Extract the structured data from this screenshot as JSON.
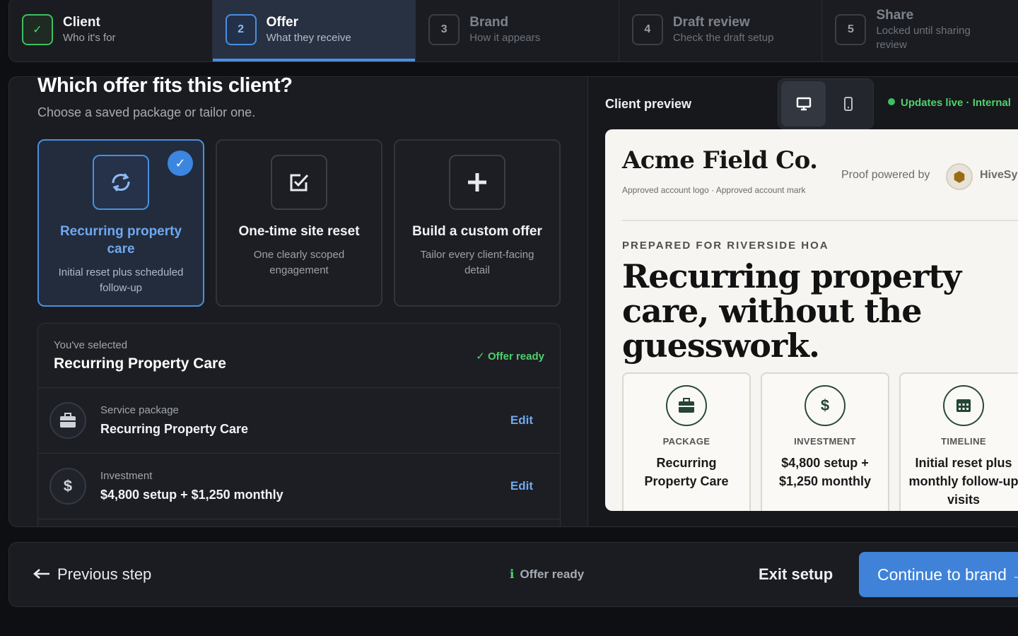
{
  "stepper": {
    "steps": [
      {
        "num": "✓",
        "title": "Client",
        "sub": "Who it's for"
      },
      {
        "num": "2",
        "title": "Offer",
        "sub": "What they receive"
      },
      {
        "num": "3",
        "title": "Brand",
        "sub": "How it appears"
      },
      {
        "num": "4",
        "title": "Draft review",
        "sub": "Check the draft setup"
      },
      {
        "num": "5",
        "title": "Share",
        "sub": "Locked until sharing review"
      }
    ]
  },
  "offer": {
    "title": "Which offer fits this client?",
    "subtitle": "Choose a saved package or tailor one.",
    "cards": [
      {
        "title": "Recurring property care",
        "desc": "Initial reset plus scheduled follow-up",
        "icon": "recurring-icon"
      },
      {
        "title": "One-time site reset",
        "desc": "One clearly scoped engagement",
        "icon": "checkbox-icon"
      },
      {
        "title": "Build a custom offer",
        "desc": "Tailor every client-facing detail",
        "icon": "plus-icon"
      }
    ]
  },
  "summary": {
    "label": "You've selected",
    "title": "Recurring Property Care",
    "status": "Offer ready",
    "rows": [
      {
        "label": "Service package",
        "value": "Recurring Property Care",
        "action": "Edit",
        "icon": "briefcase-icon"
      },
      {
        "label": "Investment",
        "value": "$4,800 setup + $1,250 monthly",
        "action": "Edit",
        "icon": "dollar-icon"
      }
    ]
  },
  "preview": {
    "title": "Client preview",
    "live": "Updates live · Internal",
    "doc": {
      "brand": "Acme Field Co.",
      "brand_sub": "Approved account logo · Approved account mark",
      "powered_by": "Proof powered by",
      "powered_name": "HiveSy",
      "prepared": "PREPARED FOR RIVERSIDE HOA",
      "headline": "Recurring property care, without the guesswork.",
      "tiles": [
        {
          "label": "PACKAGE",
          "value": "Recurring Property Care",
          "icon": "briefcase-icon"
        },
        {
          "label": "INVESTMENT",
          "value": "$4,800 setup + $1,250 monthly",
          "icon": "dollar-icon"
        },
        {
          "label": "TIMELINE",
          "value": "Initial reset plus monthly follow-up visits",
          "icon": "calendar-icon"
        }
      ]
    }
  },
  "footer": {
    "previous": "Previous step",
    "status": "Offer ready",
    "exit": "Exit setup",
    "continue": "Continue to brand →"
  },
  "colors": {
    "accent": "#3f82d8",
    "success": "#4fd16c",
    "panel": "#1a1c21"
  }
}
